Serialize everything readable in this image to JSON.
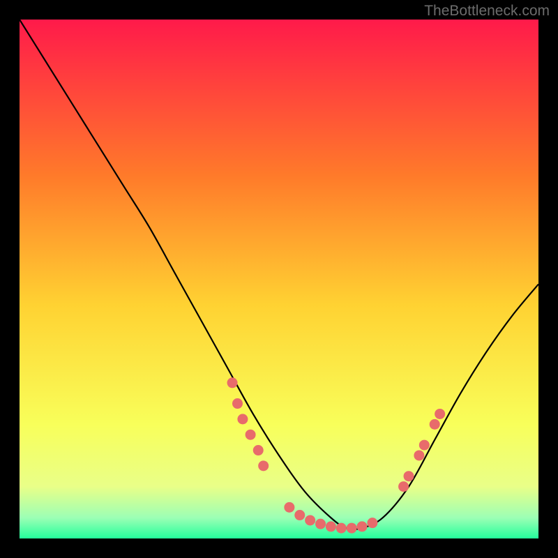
{
  "watermark": "TheBottleneck.com",
  "chart_data": {
    "type": "line",
    "title": "",
    "xlabel": "",
    "ylabel": "",
    "xlim": [
      0,
      100
    ],
    "ylim": [
      0,
      100
    ],
    "background_gradient": {
      "top": "#ff1a4a",
      "upper_mid": "#ff9a2a",
      "mid": "#ffe032",
      "lower_mid": "#f5ff60",
      "bottom": "#2cffa0"
    },
    "series": [
      {
        "name": "bottleneck-curve",
        "x": [
          0,
          5,
          10,
          15,
          20,
          25,
          30,
          35,
          40,
          45,
          50,
          55,
          60,
          63,
          66,
          70,
          75,
          80,
          85,
          90,
          95,
          100
        ],
        "y": [
          100,
          92,
          84,
          76,
          68,
          60,
          51,
          42,
          33,
          24,
          16,
          9,
          4,
          2,
          2,
          4,
          10,
          19,
          28,
          36,
          43,
          49
        ],
        "color": "#000000"
      }
    ],
    "dot_clusters": [
      {
        "name": "left-arm-dots",
        "color": "#e86b6b",
        "points": [
          {
            "x": 41,
            "y": 30
          },
          {
            "x": 42,
            "y": 26
          },
          {
            "x": 43,
            "y": 23
          },
          {
            "x": 44.5,
            "y": 20
          },
          {
            "x": 46,
            "y": 17
          },
          {
            "x": 47,
            "y": 14
          }
        ]
      },
      {
        "name": "bottom-dots",
        "color": "#e86b6b",
        "points": [
          {
            "x": 52,
            "y": 6
          },
          {
            "x": 54,
            "y": 4.5
          },
          {
            "x": 56,
            "y": 3.5
          },
          {
            "x": 58,
            "y": 2.8
          },
          {
            "x": 60,
            "y": 2.3
          },
          {
            "x": 62,
            "y": 2.0
          },
          {
            "x": 64,
            "y": 2.0
          },
          {
            "x": 66,
            "y": 2.3
          },
          {
            "x": 68,
            "y": 3.0
          }
        ]
      },
      {
        "name": "right-arm-dots",
        "color": "#e86b6b",
        "points": [
          {
            "x": 74,
            "y": 10
          },
          {
            "x": 75,
            "y": 12
          },
          {
            "x": 77,
            "y": 16
          },
          {
            "x": 78,
            "y": 18
          },
          {
            "x": 80,
            "y": 22
          },
          {
            "x": 81,
            "y": 24
          }
        ]
      }
    ]
  }
}
